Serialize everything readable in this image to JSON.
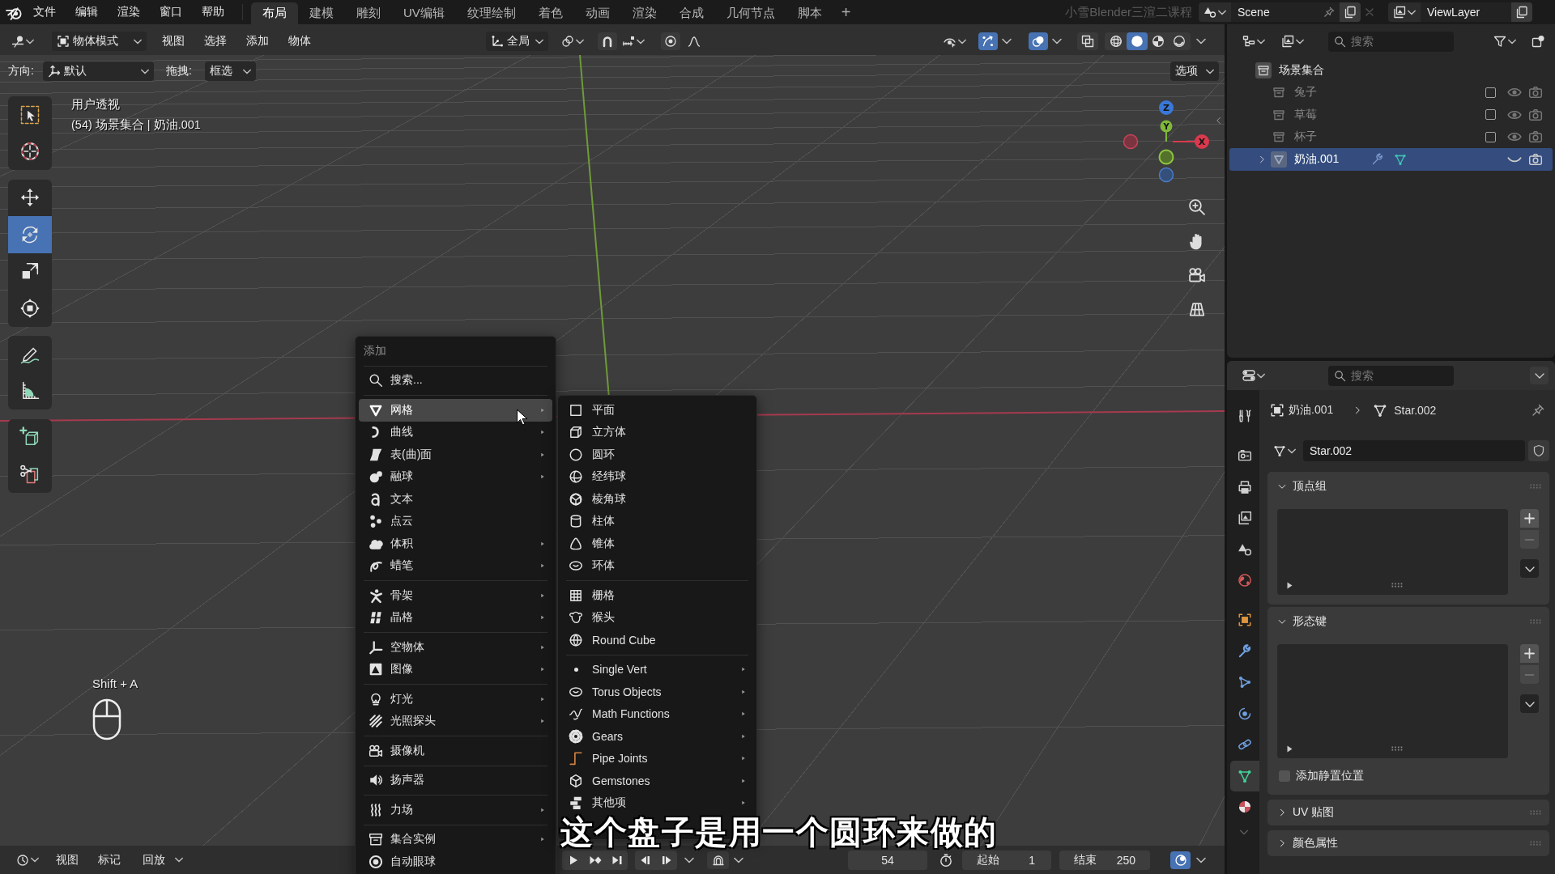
{
  "top_bar": {
    "menus": [
      "文件",
      "编辑",
      "渲染",
      "窗口",
      "帮助"
    ],
    "workspaces": [
      {
        "label": "布局",
        "selected": true
      },
      {
        "label": "建模",
        "selected": false
      },
      {
        "label": "雕刻",
        "selected": false
      },
      {
        "label": "UV编辑",
        "selected": false
      },
      {
        "label": "纹理绘制",
        "selected": false
      },
      {
        "label": "着色",
        "selected": false
      },
      {
        "label": "动画",
        "selected": false
      },
      {
        "label": "渲染",
        "selected": false
      },
      {
        "label": "合成",
        "selected": false
      },
      {
        "label": "几何节点",
        "selected": false
      },
      {
        "label": "脚本",
        "selected": false
      }
    ],
    "add_workspace": "+",
    "channel_title": "小雪Blender三渲二课程",
    "scene": "Scene",
    "view_layer": "ViewLayer"
  },
  "viewport_header": {
    "mode": "物体模式",
    "menus": [
      "视图",
      "选择",
      "添加",
      "物体"
    ],
    "orientation": "全局",
    "snap_on": false,
    "proportional_on": false,
    "gizmos_on": true,
    "overlays_on": true,
    "xray_on": false,
    "shading": [
      {
        "kind": "wireframe",
        "selected": false
      },
      {
        "kind": "solid",
        "selected": true
      },
      {
        "kind": "material",
        "selected": false
      },
      {
        "kind": "rendered",
        "selected": false
      }
    ]
  },
  "tool_settings": {
    "orientation_label": "方向:",
    "orientation": "默认",
    "drag_label": "拖拽:",
    "drag": "框选",
    "options": "选项"
  },
  "toolbar": {
    "groups": [
      {
        "tools": [
          {
            "kind": "select",
            "selected": false
          },
          {
            "kind": "cursor",
            "selected": false
          }
        ]
      },
      {
        "tools": [
          {
            "kind": "move",
            "selected": false
          },
          {
            "kind": "rotate",
            "selected": true
          },
          {
            "kind": "scale",
            "selected": false
          },
          {
            "kind": "transform",
            "selected": false
          }
        ]
      },
      {
        "tools": [
          {
            "kind": "annotate",
            "selected": false
          },
          {
            "kind": "measure",
            "selected": false
          }
        ]
      },
      {
        "tools": [
          {
            "kind": "addcube",
            "selected": false
          },
          {
            "kind": "cut",
            "selected": false
          }
        ]
      }
    ]
  },
  "viewport": {
    "view_name": "用户透视",
    "context": "(54) 场景集合 | 奶油.001",
    "axes": [
      {
        "kind": "z",
        "label": "Z"
      },
      {
        "kind": "y",
        "label": "Y"
      },
      {
        "kind": "x",
        "label": "X"
      }
    ],
    "shortcut": "Shift + A"
  },
  "add_menu": {
    "title": "添加",
    "search": "搜索...",
    "groups": [
      {
        "items": [
          {
            "label": "网格",
            "kind": "mesh",
            "submenu": true,
            "selected": true
          },
          {
            "label": "曲线",
            "kind": "curve",
            "submenu": true,
            "selected": false
          },
          {
            "label": "表(曲)面",
            "kind": "surface",
            "submenu": true,
            "selected": false
          },
          {
            "label": "融球",
            "kind": "metaball",
            "submenu": true,
            "selected": false
          },
          {
            "label": "文本",
            "kind": "text",
            "submenu": false,
            "selected": false
          },
          {
            "label": "点云",
            "kind": "pointcloud",
            "submenu": false,
            "selected": false
          },
          {
            "label": "体积",
            "kind": "volume",
            "submenu": true,
            "selected": false
          },
          {
            "label": "蜡笔",
            "kind": "greasepencil",
            "submenu": true,
            "selected": false
          }
        ]
      },
      {
        "items": [
          {
            "label": "骨架",
            "kind": "armature",
            "submenu": true,
            "selected": false
          },
          {
            "label": "晶格",
            "kind": "lattice",
            "submenu": true,
            "selected": false
          }
        ]
      },
      {
        "items": [
          {
            "label": "空物体",
            "kind": "empty",
            "submenu": true,
            "selected": false
          },
          {
            "label": "图像",
            "kind": "image",
            "submenu": true,
            "selected": false
          }
        ]
      },
      {
        "items": [
          {
            "label": "灯光",
            "kind": "light",
            "submenu": true,
            "selected": false
          },
          {
            "label": "光照探头",
            "kind": "lightprobe",
            "submenu": true,
            "selected": false
          }
        ]
      },
      {
        "items": [
          {
            "label": "摄像机",
            "kind": "camera",
            "submenu": false,
            "selected": false
          }
        ]
      },
      {
        "items": [
          {
            "label": "扬声器",
            "kind": "speaker",
            "submenu": false,
            "selected": false
          }
        ]
      },
      {
        "items": [
          {
            "label": "力场",
            "kind": "forcefield",
            "submenu": true,
            "selected": false
          }
        ]
      },
      {
        "items": [
          {
            "label": "集合实例",
            "kind": "collection",
            "submenu": true,
            "selected": false
          },
          {
            "label": "自动眼球",
            "kind": "eyeball",
            "submenu": false,
            "selected": false
          }
        ]
      }
    ]
  },
  "mesh_submenu": {
    "groups": [
      {
        "items": [
          {
            "label": "平面",
            "kind": "plane",
            "submenu": false,
            "selected": false
          },
          {
            "label": "立方体",
            "kind": "cube",
            "submenu": false,
            "selected": false
          },
          {
            "label": "圆环",
            "kind": "circle",
            "submenu": false,
            "selected": false
          },
          {
            "label": "经纬球",
            "kind": "uvsphere",
            "submenu": false,
            "selected": false
          },
          {
            "label": "棱角球",
            "kind": "icosphere",
            "submenu": false,
            "selected": false
          },
          {
            "label": "柱体",
            "kind": "cylinder",
            "submenu": false,
            "selected": false
          },
          {
            "label": "锥体",
            "kind": "cone",
            "submenu": false,
            "selected": false
          },
          {
            "label": "环体",
            "kind": "torus",
            "submenu": false,
            "selected": false
          }
        ]
      },
      {
        "items": [
          {
            "label": "栅格",
            "kind": "grid",
            "submenu": false,
            "selected": false
          },
          {
            "label": "猴头",
            "kind": "monkey",
            "submenu": false,
            "selected": false
          },
          {
            "label": "Round Cube",
            "kind": "roundcube",
            "submenu": false,
            "selected": false
          }
        ]
      },
      {
        "items": [
          {
            "label": "Single Vert",
            "kind": "vert",
            "submenu": true,
            "selected": false
          },
          {
            "label": "Torus Objects",
            "kind": "torusobj",
            "submenu": true,
            "selected": false
          },
          {
            "label": "Math Functions",
            "kind": "math",
            "submenu": true,
            "selected": false
          },
          {
            "label": "Gears",
            "kind": "gears",
            "submenu": true,
            "selected": false
          },
          {
            "label": "Pipe Joints",
            "kind": "pipe",
            "submenu": true,
            "selected": false
          },
          {
            "label": "Gemstones",
            "kind": "gem",
            "submenu": true,
            "selected": false
          },
          {
            "label": "其他项",
            "kind": "misc",
            "submenu": true,
            "selected": false
          }
        ]
      }
    ]
  },
  "subtitle": "这个盘子是用一个圆环来做的",
  "timeline_header": {
    "menus": [
      {
        "label": "视图",
        "dropdown": false
      },
      {
        "label": "标记",
        "dropdown": false
      },
      {
        "label": "回放",
        "dropdown": true
      }
    ],
    "snap_on": false,
    "current_frame": "54",
    "start_label": "起始",
    "start": "1",
    "end_label": "结束",
    "end": "250",
    "ring_toggle_on": true
  },
  "outliner": {
    "search_placeholder": "搜索",
    "tree": [
      {
        "label": "场景集合",
        "kind": "scene_collection",
        "selected": false,
        "children": [
          {
            "label": "兔子",
            "kind": "collection",
            "checked": false,
            "visible": true,
            "selected": false
          },
          {
            "label": "草莓",
            "kind": "collection",
            "checked": false,
            "visible": true,
            "selected": false
          },
          {
            "label": "杯子",
            "kind": "collection",
            "checked": false,
            "visible": true,
            "selected": false
          },
          {
            "label": "奶油.001",
            "kind": "object",
            "expanded": false,
            "visible": false,
            "selected": true
          }
        ]
      }
    ]
  },
  "properties": {
    "search_placeholder": "搜索",
    "tab_groups": [
      {
        "tabs": [
          {
            "kind": "tool",
            "selected": false
          }
        ]
      },
      {
        "tabs": [
          {
            "kind": "render",
            "selected": false
          },
          {
            "kind": "output",
            "selected": false
          },
          {
            "kind": "viewlayer",
            "selected": false
          },
          {
            "kind": "scene",
            "selected": false
          },
          {
            "kind": "world",
            "selected": false
          }
        ]
      },
      {
        "tabs": [
          {
            "kind": "object",
            "selected": false
          },
          {
            "kind": "modifiers",
            "selected": false
          },
          {
            "kind": "particles",
            "selected": false
          },
          {
            "kind": "physics",
            "selected": false
          },
          {
            "kind": "constraints",
            "selected": false
          },
          {
            "kind": "data",
            "selected": true
          },
          {
            "kind": "material",
            "selected": false
          }
        ]
      }
    ],
    "object": "奶油.001",
    "data": "Star.002",
    "datablock": "Star.002",
    "panels": [
      {
        "title": "顶点组",
        "expanded": true
      },
      {
        "title": "形态键",
        "expanded": true,
        "option": {
          "label": "添加静置位置",
          "checked": false
        }
      },
      {
        "title": "UV 贴图",
        "expanded": false
      },
      {
        "title": "颜色属性",
        "expanded": false
      }
    ]
  }
}
